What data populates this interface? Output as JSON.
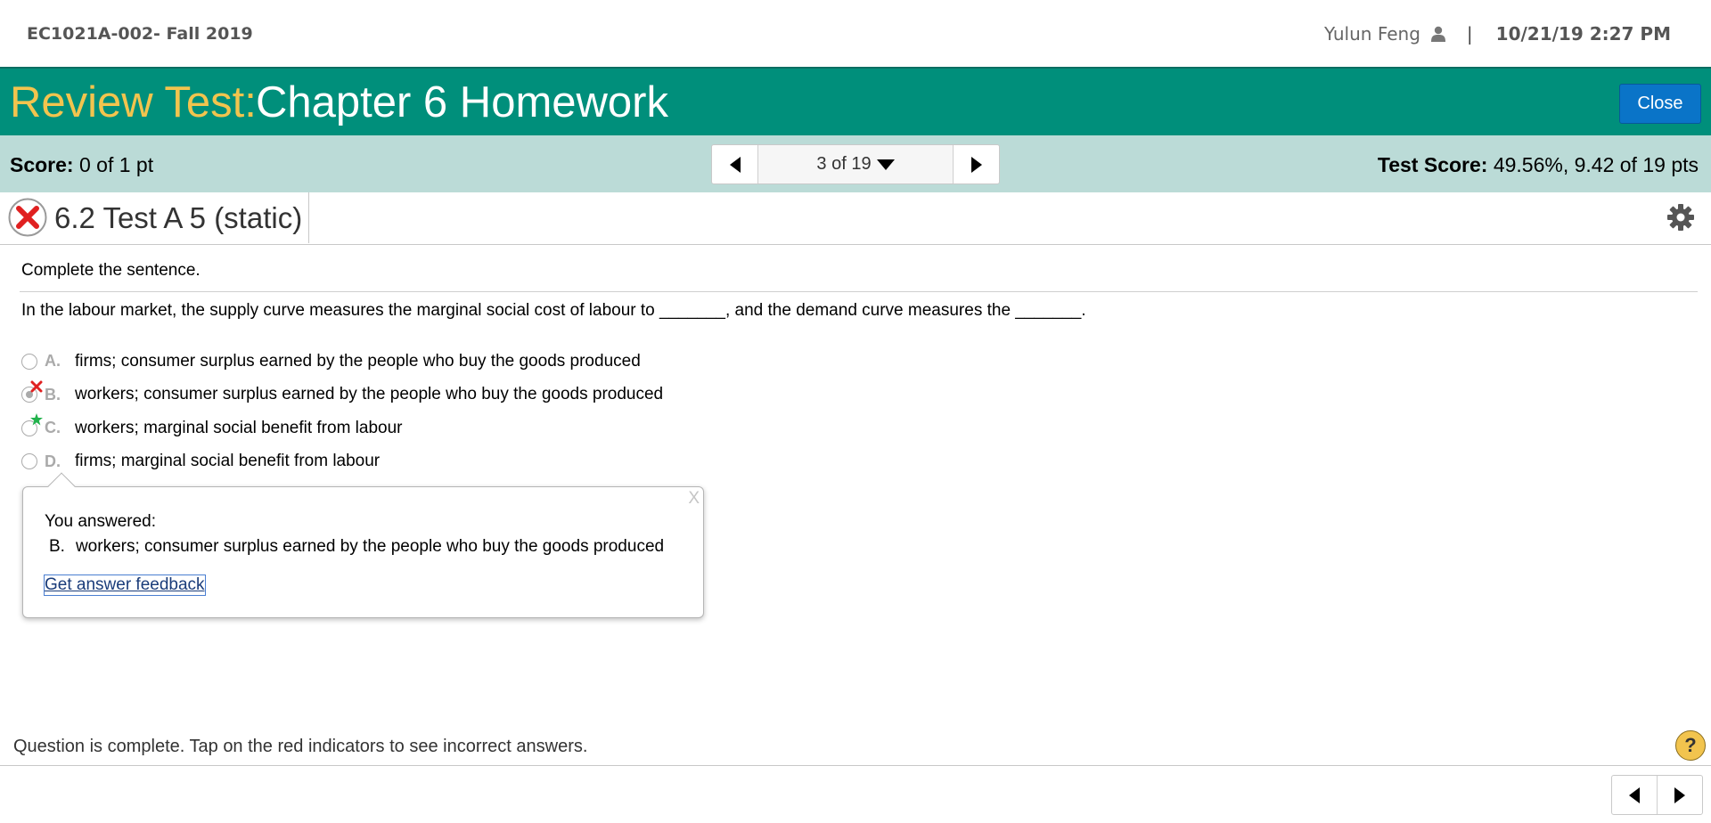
{
  "header": {
    "course": "EC1021A-002- Fall 2019",
    "user_name": "Yulun Feng",
    "separator": "|",
    "datetime": "10/21/19 2:27 PM"
  },
  "title": {
    "prefix": "Review Test:",
    "main": "Chapter 6 Homework",
    "close_label": "Close"
  },
  "scorebar": {
    "score_label": "Score:",
    "score_value": "0 of 1 pt",
    "nav_position": "3 of 19",
    "test_score_label": "Test Score:",
    "test_score_value": "49.56%, 9.42 of 19 pts"
  },
  "question": {
    "title": "6.2 Test A 5 (static)",
    "status": "incorrect",
    "instruction": "Complete the sentence.",
    "prompt": "In the labour market, the supply curve measures the marginal social cost of labour to _______, and the demand curve measures the _______.",
    "options": [
      {
        "letter": "A.",
        "text": "firms; consumer surplus earned by the people who buy the goods produced",
        "selected": false,
        "mark": ""
      },
      {
        "letter": "B.",
        "text": "workers; consumer surplus earned by the people who buy the goods produced",
        "selected": true,
        "mark": "incorrect"
      },
      {
        "letter": "C.",
        "text": "workers; marginal social benefit from labour",
        "selected": false,
        "mark": "correct"
      },
      {
        "letter": "D.",
        "text": "firms; marginal social benefit from labour",
        "selected": false,
        "mark": ""
      }
    ]
  },
  "popup": {
    "close": "X",
    "label": "You answered:",
    "answer_letter": "B.",
    "answer_text": "workers; consumer surplus earned by the people who buy the goods produced",
    "link": "Get answer feedback"
  },
  "footer": {
    "status": "Question is complete. Tap on the red indicators to see incorrect answers.",
    "help": "?"
  },
  "colors": {
    "title_bar": "#008f7b",
    "title_prefix": "#f2c44e",
    "score_bar": "#bbdbd7",
    "close_button": "#0a74c8",
    "incorrect": "#e02020",
    "correct": "#22b24c"
  }
}
